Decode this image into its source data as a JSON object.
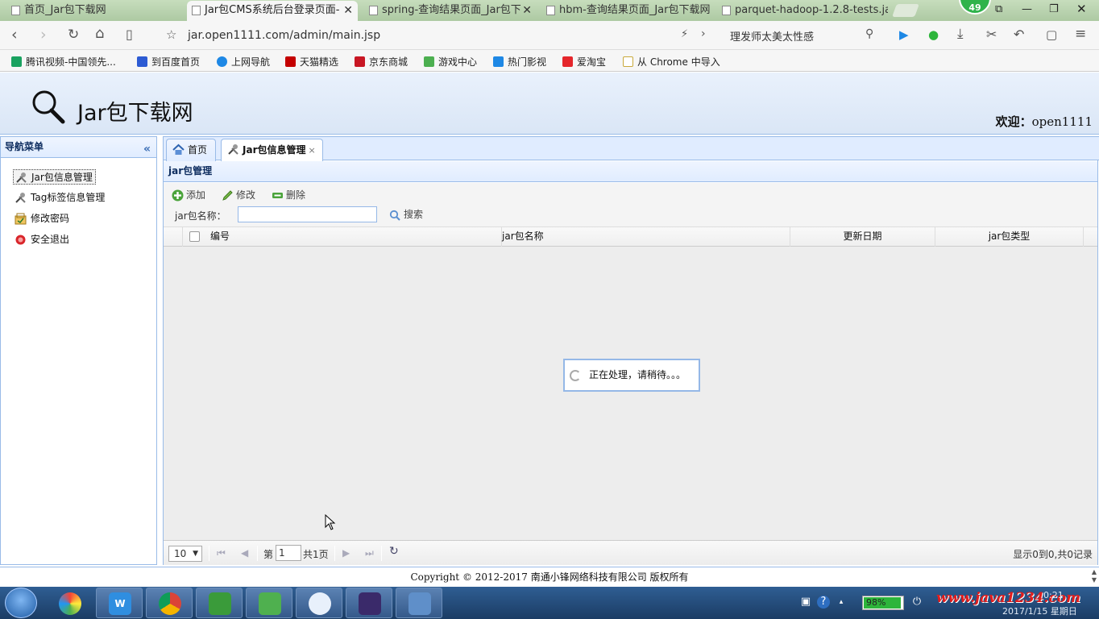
{
  "browser": {
    "tabs": [
      {
        "title": "首页_Jar包下载网"
      },
      {
        "title": "Jar包CMS系统后台登录页面-"
      },
      {
        "title": "spring-查询结果页面_Jar包下"
      },
      {
        "title": "hbm-查询结果页面_Jar包下载网"
      },
      {
        "title": "parquet-hadoop-1.2.8-tests.ja"
      }
    ],
    "active_tab": 1,
    "avatar_badge": "49",
    "url": "jar.open1111.com/admin/main.jsp",
    "search_text": "理发师太美太性感",
    "bookmarks": [
      {
        "label": "腾讯视频-中国领先...",
        "color": "#1aa260"
      },
      {
        "label": "到百度首页",
        "color": "#2d5bd3"
      },
      {
        "label": "上网导航",
        "color": "#1e88e5"
      },
      {
        "label": "天猫精选",
        "color": "#c40000"
      },
      {
        "label": "京东商城",
        "color": "#c81623"
      },
      {
        "label": "游戏中心",
        "color": "#4caf50"
      },
      {
        "label": "热门影视",
        "color": "#1e88e5"
      },
      {
        "label": "爱淘宝",
        "color": "#e5262b"
      },
      {
        "label": "从 Chrome 中导入",
        "color": "#f2c94c"
      }
    ]
  },
  "header": {
    "site_title": "Jar包下载网",
    "welcome_label": "欢迎：",
    "username": "open1111"
  },
  "west": {
    "title": "导航菜单",
    "collapse_glyph": "«",
    "items": [
      {
        "label": "Jar包信息管理"
      },
      {
        "label": "Tag标签信息管理"
      },
      {
        "label": "修改密码"
      },
      {
        "label": "安全退出"
      }
    ]
  },
  "center": {
    "tabs": [
      {
        "label": "首页"
      },
      {
        "label": "Jar包信息管理",
        "close": "×"
      }
    ],
    "grid_title": "jar包管理",
    "toolbar": {
      "add": "添加",
      "edit": "修改",
      "delete": "删除",
      "search_label": "jar包名称：",
      "search_value": "",
      "search_button": "搜索"
    },
    "columns": [
      "编号",
      "jar包名称",
      "更新日期",
      "jar包类型"
    ],
    "loading_text": "正在处理，请稍待。。。",
    "pager": {
      "page_size": "10",
      "page_prefix": "第",
      "page_value": "1",
      "page_suffix": "共1页",
      "info": "显示0到0,共0记录"
    }
  },
  "footer": {
    "copyright": "Copyright © 2012-2017 南通小锋网络科技有限公司 版权所有"
  },
  "taskbar": {
    "battery": "98%",
    "watermark": "www.java1234.com",
    "time": "0:21",
    "date": "2017/1/15 星期日"
  }
}
